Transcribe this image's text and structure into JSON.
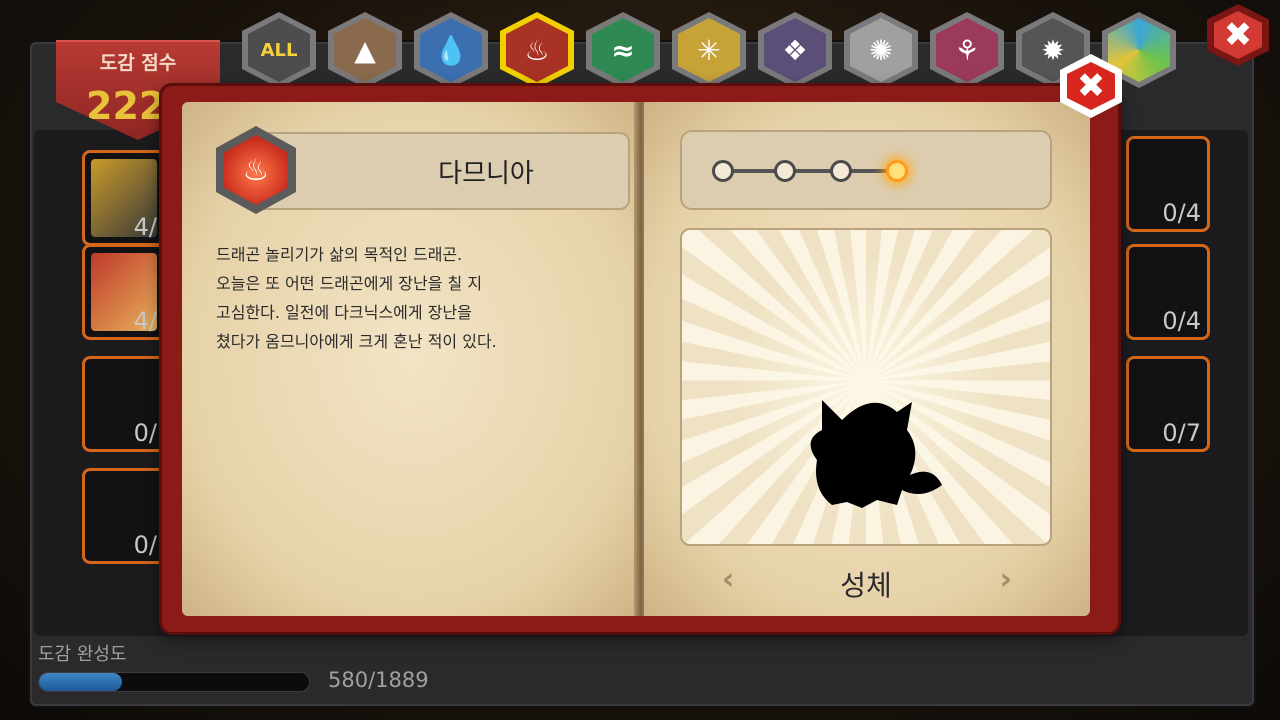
{
  "header": {
    "score_label": "도감 점수",
    "score_value": "222"
  },
  "tabs": [
    {
      "id": "all",
      "label": "ALL",
      "icon": "all-icon",
      "active": false
    },
    {
      "id": "earth",
      "label": "",
      "icon": "earth-element-icon",
      "active": false
    },
    {
      "id": "water",
      "label": "",
      "icon": "water-element-icon",
      "active": false
    },
    {
      "id": "fire",
      "label": "",
      "icon": "fire-element-icon",
      "active": true
    },
    {
      "id": "wind",
      "label": "",
      "icon": "wind-element-icon",
      "active": false
    },
    {
      "id": "light",
      "label": "",
      "icon": "light-element-icon",
      "active": false
    },
    {
      "id": "dark",
      "label": "",
      "icon": "dark-element-icon",
      "active": false
    },
    {
      "id": "metal",
      "label": "",
      "icon": "metal-element-icon",
      "active": false
    },
    {
      "id": "blood",
      "label": "",
      "icon": "blood-element-icon",
      "active": false
    },
    {
      "id": "void",
      "label": "",
      "icon": "void-element-icon",
      "active": false
    },
    {
      "id": "chaos",
      "label": "",
      "icon": "chaos-element-icon",
      "active": false
    }
  ],
  "side_cards": {
    "left": [
      {
        "count": "4/"
      },
      {
        "count": "4/"
      },
      {
        "count": "0/"
      },
      {
        "count": "0/"
      }
    ],
    "right": [
      {
        "count": "0/4"
      },
      {
        "count": "0/4"
      },
      {
        "count": "0/7"
      }
    ]
  },
  "book": {
    "element_icon": "fire-emblem-icon",
    "name": "다므니아",
    "description": "드래곤 놀리기가 삶의 목적인 드래곤.\n오늘은 또 어떤 드래곤에게 장난을 칠 지\n고심한다. 일전에 다크닉스에게 장난을\n쳤다가 옴므니아에게 크게 혼난 적이 있다.",
    "stages_total": 4,
    "stage_current": 4,
    "form_label": "성체",
    "prev_symbol": "‹",
    "next_symbol": "›"
  },
  "progress": {
    "label": "도감 완성도",
    "text": "580/1889",
    "fraction": 0.307
  },
  "colors": {
    "accent_red": "#d23a33",
    "score_gold": "#e8c23a",
    "active_tab": "#f2d000",
    "progress_blue": "#3f86c8"
  }
}
